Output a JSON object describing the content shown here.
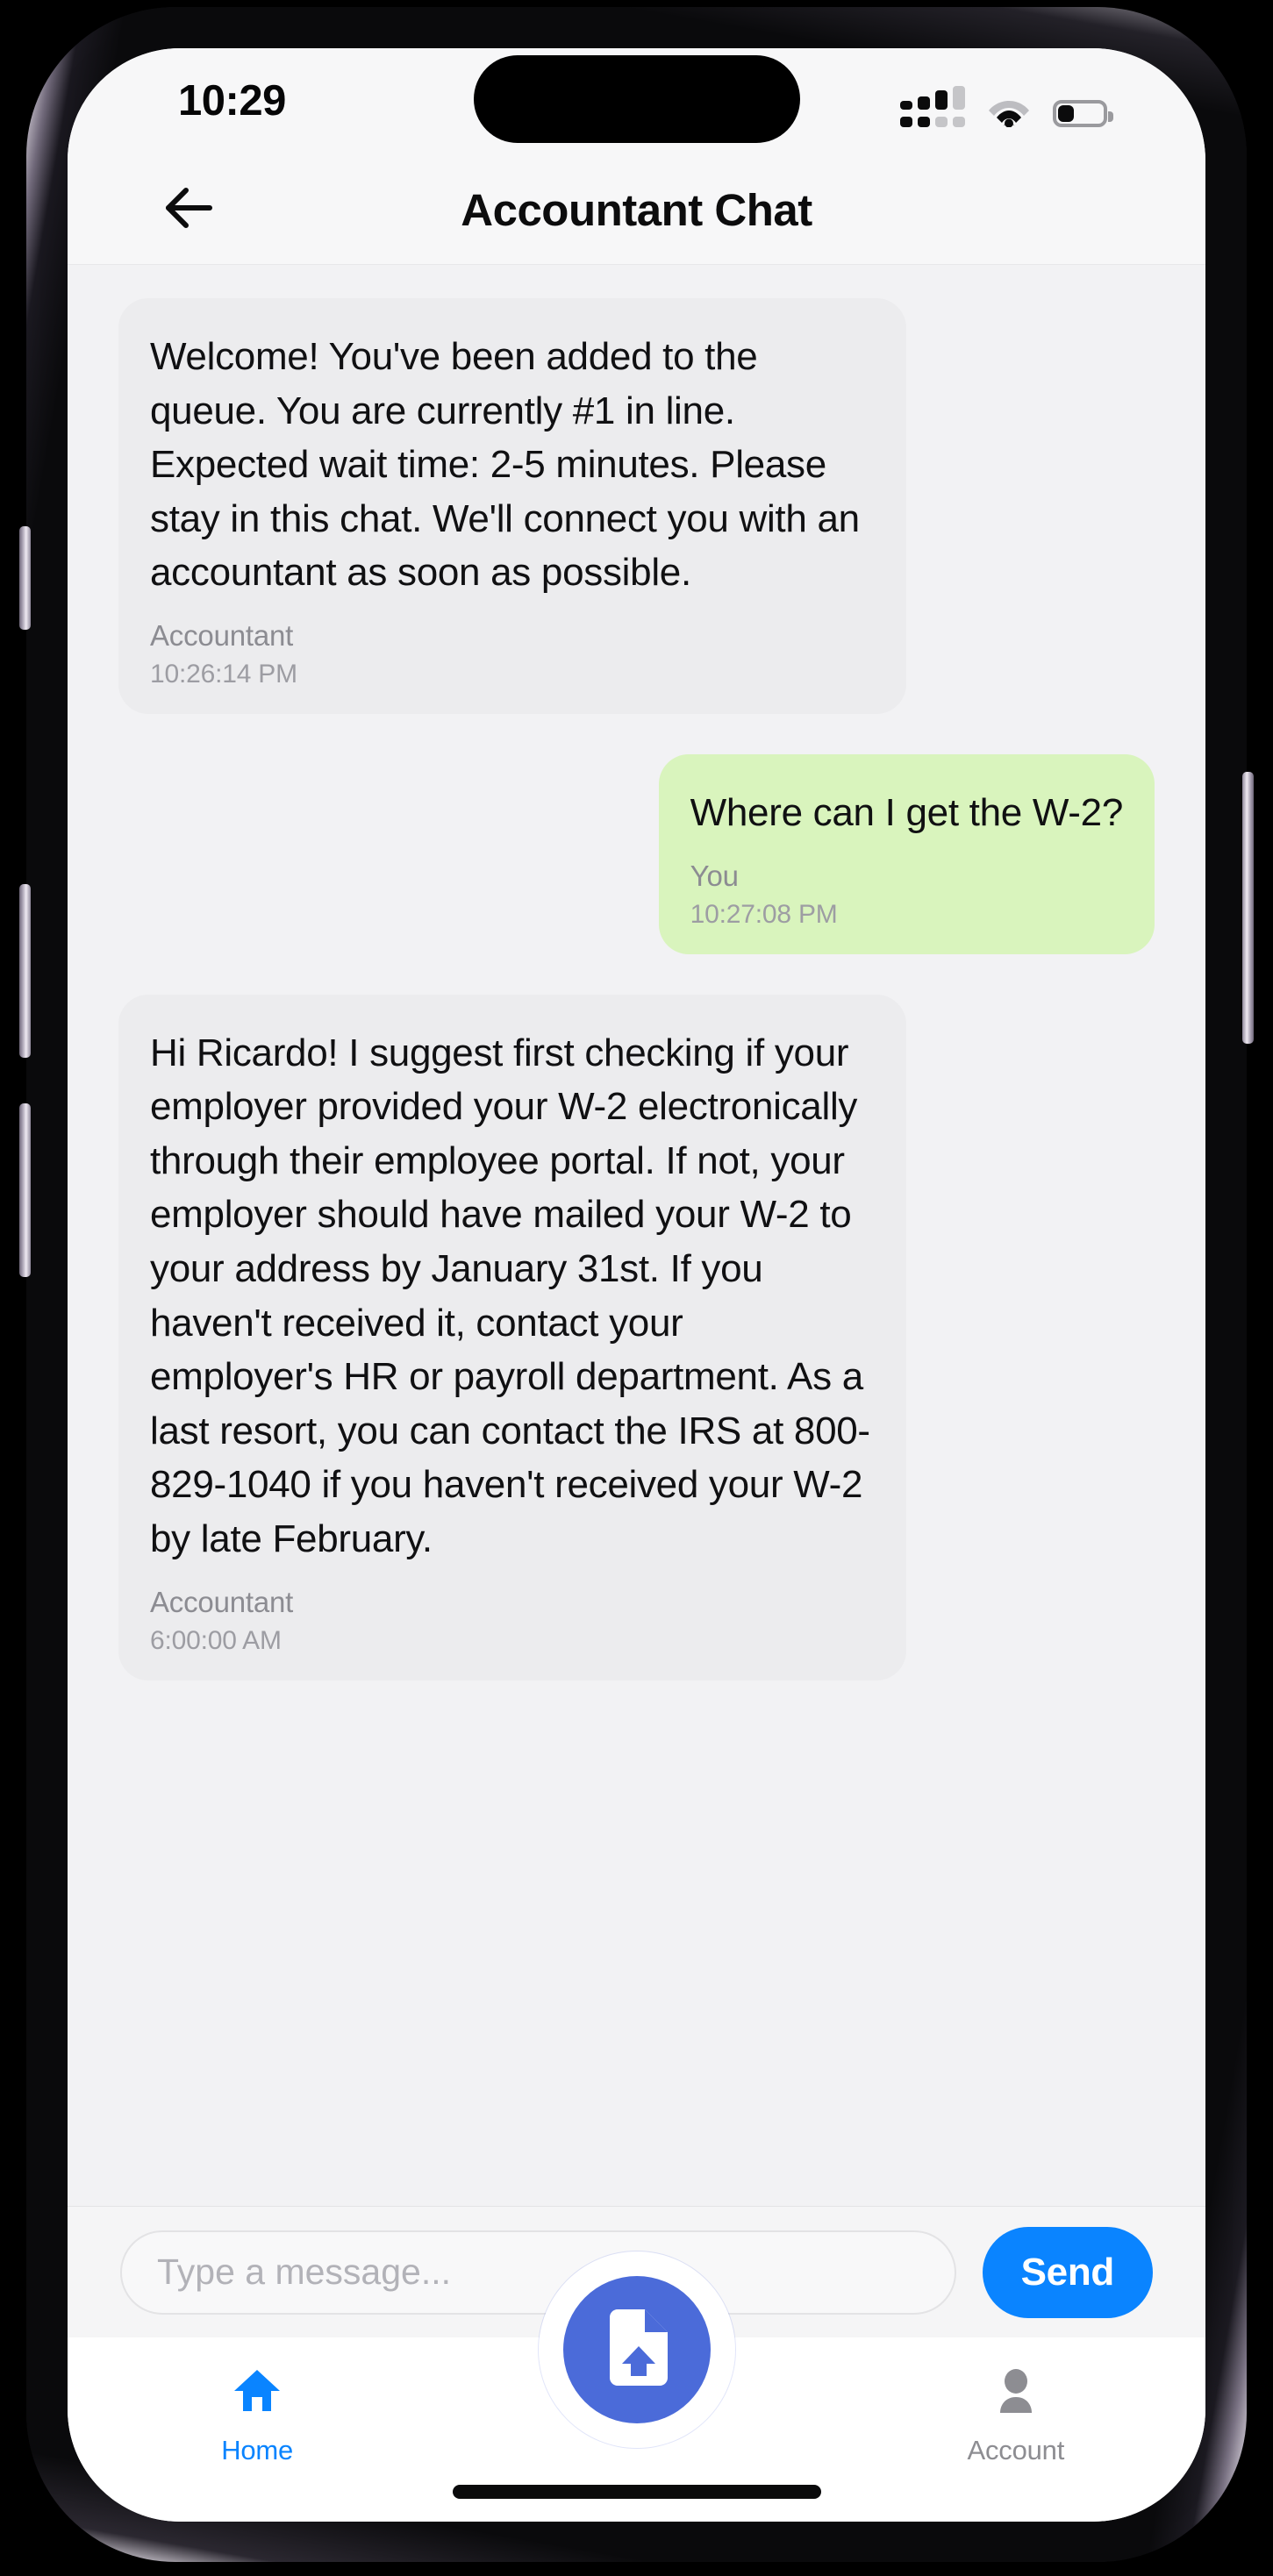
{
  "status_bar": {
    "time": "10:29",
    "cellular_icon": "cellular-signal-icon",
    "wifi_icon": "wifi-icon",
    "battery_icon": "battery-icon",
    "battery_level_percent": 34
  },
  "header": {
    "back_icon": "back-arrow-icon",
    "title": "Accountant Chat"
  },
  "chat": {
    "messages": [
      {
        "side": "left",
        "sender": "Accountant",
        "time": "10:26:14 PM",
        "text": "Welcome! You've been added to the queue. You are currently #1 in line. Expected wait time: 2-5 minutes. Please stay in this chat. We'll connect you with an accountant as soon as possible."
      },
      {
        "side": "right",
        "sender": "You",
        "time": "10:27:08 PM",
        "text": "Where can I get the W-2?"
      },
      {
        "side": "left",
        "sender": "Accountant",
        "time": "6:00:00 AM",
        "text": "Hi Ricardo! I suggest first checking if your employer provided your W-2 electronically through their employee portal. If not, your employer should have mailed your W-2 to your address by January 31st. If you haven't received it, contact your employer's HR or payroll department. As a last resort, you can contact the IRS at 800-829-1040 if you haven't received your W-2 by late February."
      }
    ]
  },
  "composer": {
    "input_value": "",
    "input_placeholder": "Type a message...",
    "send_label": "Send"
  },
  "tabbar": {
    "home_label": "Home",
    "home_icon": "home-icon",
    "account_label": "Account",
    "account_icon": "person-icon",
    "fab_icon": "document-upload-icon"
  },
  "colors": {
    "accent_blue": "#0a84ff",
    "fab_blue": "#4b6bd9",
    "user_bubble": "#d9f4bd",
    "agent_bubble": "#ececee",
    "screen_bg": "#f2f2f4"
  }
}
